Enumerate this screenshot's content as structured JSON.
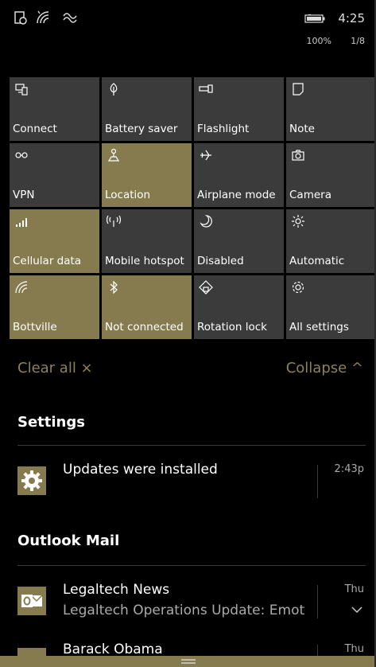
{
  "status_bar": {
    "icons": [
      "screen-rotation-icon",
      "wifi-signal-icon",
      "vibrate-icon"
    ],
    "time": "4:25",
    "battery_percent": "100%",
    "page_indicator": "1/8"
  },
  "quick_actions": [
    {
      "label": "Connect",
      "icon": "connect-icon",
      "active": false
    },
    {
      "label": "Battery saver",
      "icon": "battery-saver-icon",
      "active": false
    },
    {
      "label": "Flashlight",
      "icon": "flashlight-icon",
      "active": false
    },
    {
      "label": "Note",
      "icon": "note-icon",
      "active": false
    },
    {
      "label": "VPN",
      "icon": "vpn-icon",
      "active": false
    },
    {
      "label": "Location",
      "icon": "location-icon",
      "active": true
    },
    {
      "label": "Airplane mode",
      "icon": "airplane-icon",
      "active": false
    },
    {
      "label": "Camera",
      "icon": "camera-icon",
      "active": false
    },
    {
      "label": "Cellular data",
      "icon": "cellular-icon",
      "active": true
    },
    {
      "label": "Mobile hotspot",
      "icon": "hotspot-icon",
      "active": false
    },
    {
      "label": "Disabled",
      "icon": "moon-icon",
      "active": false
    },
    {
      "label": "Automatic",
      "icon": "brightness-icon",
      "active": false
    },
    {
      "label": "Bottville",
      "icon": "wifi-icon",
      "active": true
    },
    {
      "label": "Not connected",
      "icon": "bluetooth-icon",
      "active": true
    },
    {
      "label": "Rotation lock",
      "icon": "rotation-lock-icon",
      "active": false
    },
    {
      "label": "All settings",
      "icon": "settings-icon",
      "active": false
    }
  ],
  "actions": {
    "clear_all": "Clear all ×",
    "collapse": "Collapse ^"
  },
  "groups": {
    "settings": {
      "title": "Settings",
      "notification": {
        "title": "Updates were installed",
        "time": "2:43p"
      }
    },
    "outlook": {
      "title": "Outlook Mail",
      "notifications": [
        {
          "title": "Legaltech News",
          "body": "Legaltech Operations Update: Emot",
          "time": "Thu"
        },
        {
          "title": "Barack Obama",
          "time": "Thu"
        }
      ]
    }
  },
  "colors": {
    "accent": "#857b4f",
    "tile": "#3b3b3b",
    "background": "#000000"
  }
}
